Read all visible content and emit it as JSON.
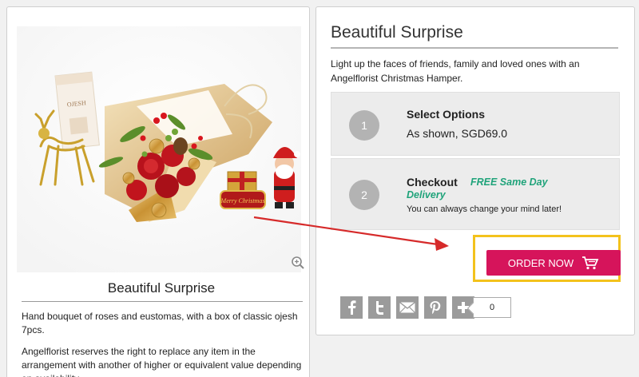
{
  "product_card": {
    "title": "Beautiful Surprise",
    "description": "Hand bouquet of roses and eustomas, with a box of classic ojesh 7pcs.",
    "note": "Angelflorist reserves the right to replace any item in the arrangement with another of higher or equivalent value depending on availability.",
    "hamper_sign": "Merry Christmas",
    "gift_box_label": "OJESH"
  },
  "order_panel": {
    "title": "Beautiful Surprise",
    "intro": "Light up the faces of friends, family and loved ones with an Angelflorist Christmas Hamper.",
    "steps": [
      {
        "number": "1",
        "heading": "Select Options",
        "detail": "As shown, SGD69.0"
      },
      {
        "number": "2",
        "heading": "Checkout",
        "badge": "FREE Same Day Delivery",
        "detail": "You can always change your mind later!"
      }
    ],
    "order_button": "ORDER NOW",
    "share_count": "0",
    "share_icons": [
      "facebook-icon",
      "twitter-icon",
      "email-icon",
      "pinterest-icon",
      "plus-icon"
    ]
  },
  "colors": {
    "order_button": "#d6145b",
    "highlight_box": "#f3c21c",
    "free_delivery": "#1fa37a",
    "arrow": "#d62a2a"
  }
}
